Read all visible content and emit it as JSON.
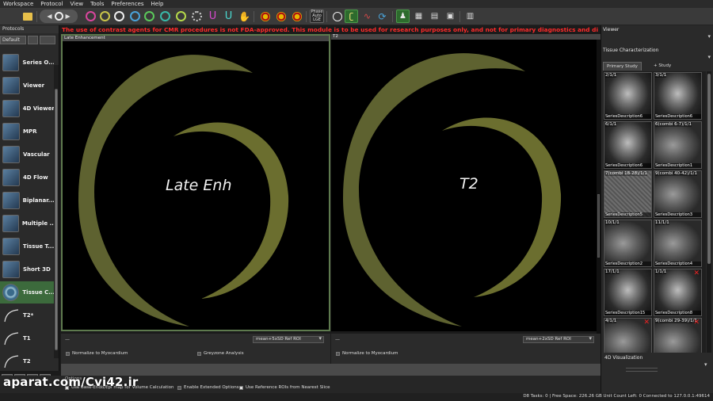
{
  "menu": [
    "Workspace",
    "Protocol",
    "View",
    "Tools",
    "Preferences",
    "Help"
  ],
  "toolbar": {
    "phase_text": "Phase\nAuto\nLGE",
    "icons": [
      "open-icon",
      "back-icon",
      "cine-ring-icon",
      "forward-icon",
      "contour-pink-icon",
      "contour-yellow-icon",
      "contour-white-icon",
      "contour-blue-icon",
      "contour-green-icon",
      "contour-teal-icon",
      "magnet-pink-icon",
      "magnet-blue-icon",
      "hand-icon",
      "dot-red-icon",
      "dot-orange-icon",
      "dot-yellow-icon",
      "phase-lge-icon",
      "grid-icon",
      "active-tool-icon",
      "refresh-icon",
      "stat-icon",
      "bars-icon",
      "list-icon",
      "chart-icon"
    ]
  },
  "protocols": {
    "header": "Protocols",
    "preset": "Default",
    "items": [
      {
        "label": "Series O...",
        "icon": "series-overview-icon"
      },
      {
        "label": "Viewer",
        "icon": "viewer-icon"
      },
      {
        "label": "4D Viewer",
        "icon": "4d-viewer-icon"
      },
      {
        "label": "MPR",
        "icon": "mpr-icon"
      },
      {
        "label": "Vascular",
        "icon": "vascular-icon"
      },
      {
        "label": "4D Flow",
        "icon": "4d-flow-icon"
      },
      {
        "label": "Biplanar...",
        "icon": "biplanar-icon"
      },
      {
        "label": "Multiple ...",
        "icon": "multiple-icon"
      },
      {
        "label": "Tissue T...",
        "icon": "tissue-tracking-icon"
      },
      {
        "label": "Short 3D",
        "icon": "short-3d-icon"
      },
      {
        "label": "Tissue C...",
        "icon": "tissue-characterization-icon",
        "active": true
      },
      {
        "label": "T2*",
        "icon": "t2star-curve-icon",
        "sub": "T2*"
      },
      {
        "label": "T1",
        "icon": "t1-curve-icon",
        "sub": "T1"
      },
      {
        "label": "T2",
        "icon": "t2-curve-icon",
        "sub": "T2"
      }
    ]
  },
  "warning": "The use of contrast agents for CMR procedures is not FDA-approved. This module is to be used for research purposes only, and not for primary diagnostics and di",
  "viewports": {
    "left": {
      "title": "Late Enhancement",
      "label": "Late Enh",
      "roi": "mean+5xSD Ref ROI",
      "check1": "Normalize to Myocardium",
      "check2": "Greyzone Analysis"
    },
    "right": {
      "title": "T2",
      "label": "T2",
      "roi": "mean+2xSD Ref ROI",
      "check1": "Normalize to Myocardium"
    }
  },
  "options": {
    "label": "Options",
    "use_base": "Use Base-Endo/Epi map for Volume Calculation",
    "enable_extended": "Enable Extended Options",
    "use_reference": "Use Reference ROIs from Nearest Slice"
  },
  "watermark": "aparat.com/Cvi42.ir",
  "status": "D8 Tasks: 0 | Free Space: 226.26 GB  Unit Count Left: 0  Connected to 127.0.0.1:49614",
  "right_panel": {
    "viewer": "Viewer",
    "tissue": "Tissue Characterization",
    "tabs": [
      "Primary Study",
      "+ Study"
    ],
    "thumbs": [
      {
        "idx": "2/1/1",
        "desc": "SeriesDescription6",
        "style": "normal"
      },
      {
        "idx": "3/1/1",
        "desc": "SeriesDescription6",
        "style": "normal"
      },
      {
        "idx": "6/1/1",
        "desc": "SeriesDescription6",
        "style": "normal"
      },
      {
        "idx": "6(combi 6-7)/1/1",
        "desc": "SeriesDescription1",
        "style": "mid"
      },
      {
        "idx": "7(combi 18-28)/1/1",
        "desc": "SeriesDescription5",
        "style": "noise"
      },
      {
        "idx": "9(combi 40-42)/1/1",
        "desc": "SeriesDescription3",
        "style": "mid"
      },
      {
        "idx": "10/1/1",
        "desc": "SeriesDescription2",
        "style": "mid"
      },
      {
        "idx": "11/1/1",
        "desc": "SeriesDescription4",
        "style": "mid"
      },
      {
        "idx": "17/1/1",
        "desc": "SeriesDescription15",
        "style": "normal"
      },
      {
        "idx": "1/1/1",
        "desc": "SeriesDescription8",
        "style": "normal",
        "x": true
      },
      {
        "idx": "4/1/1",
        "desc": "",
        "style": "mid",
        "x": true
      },
      {
        "idx": "9(combi 29-39)/1/1",
        "desc": "",
        "style": "mid",
        "x": true
      }
    ],
    "vis4d": "4D Visualization"
  },
  "colors": {
    "accent": "#2d6b2d",
    "warning": "#ff2a2a",
    "myocardium": "#6b6e2f"
  }
}
